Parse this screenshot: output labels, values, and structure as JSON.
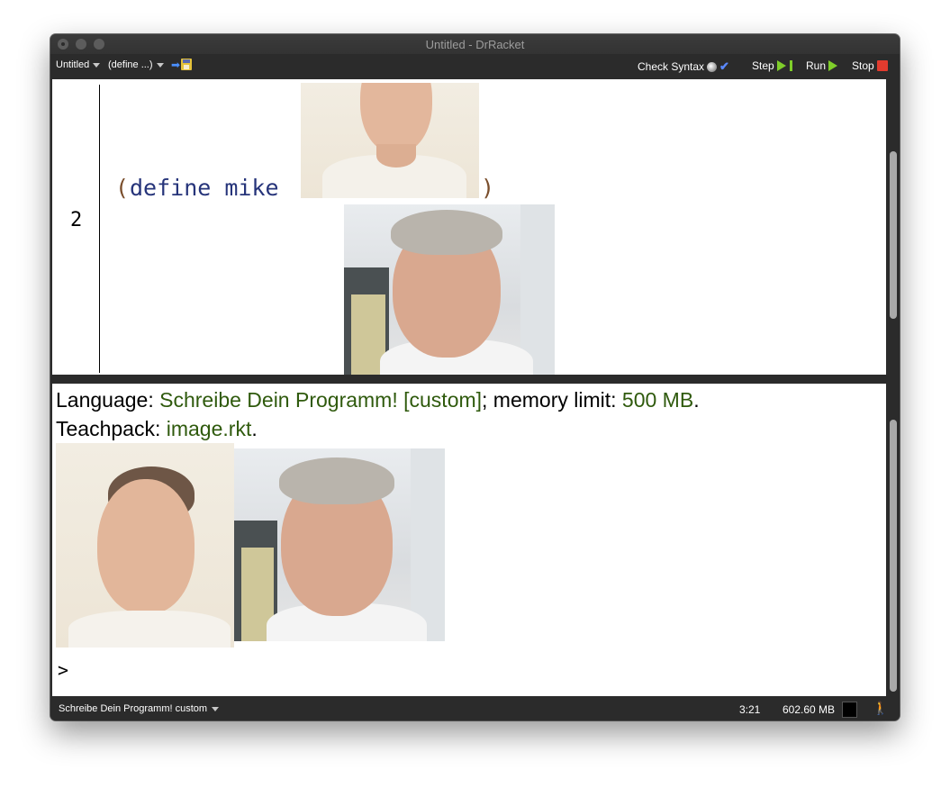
{
  "window": {
    "title": "Untitled - DrRacket"
  },
  "toolbar": {
    "file_menu": "Untitled",
    "define_menu": "(define ...)",
    "check_syntax": "Check Syntax",
    "step": "Step",
    "run": "Run",
    "stop": "Stop"
  },
  "definitions": {
    "line_number": "2",
    "open_paren": "(",
    "keyword": "define mike",
    "close_paren": ")"
  },
  "interactions": {
    "language_label": "Language: ",
    "language_value": "Schreibe Dein Programm! [custom]",
    "memory_label": "; memory limit: ",
    "memory_value": "500 MB",
    "memory_end": ".",
    "teachpack_label": "Teachpack: ",
    "teachpack_value": "image.rkt",
    "teachpack_end": ".",
    "prompt": ">"
  },
  "statusbar": {
    "language": "Schreibe Dein Programm! custom",
    "position": "3:21",
    "memory": "602.60 MB"
  },
  "colors": {
    "paren": "#7a4e2c",
    "keyword": "#26347a",
    "green_value": "#2f5a0d",
    "run_green": "#7fce2a",
    "stop_red": "#e23b2e"
  }
}
